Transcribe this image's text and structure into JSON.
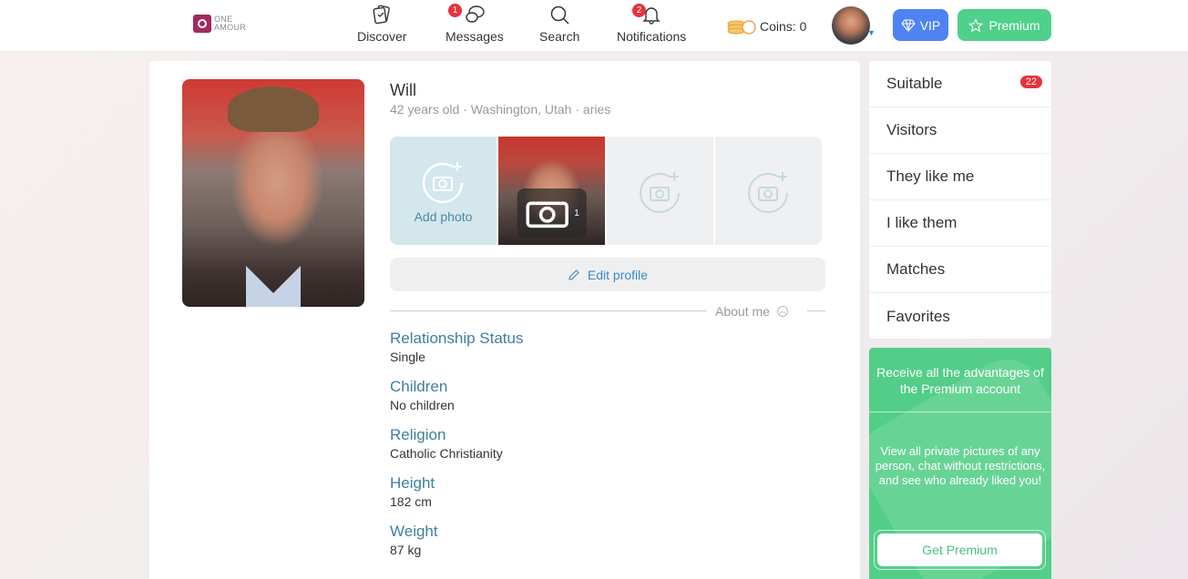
{
  "header": {
    "logo": {
      "line1": "ONE",
      "line2": "AMOUR"
    },
    "nav": [
      {
        "label": "Discover",
        "icon": "cards-icon",
        "badge": null
      },
      {
        "label": "Messages",
        "icon": "chat-bubbles-icon",
        "badge": "1"
      },
      {
        "label": "Search",
        "icon": "search-icon",
        "badge": null
      },
      {
        "label": "Notifications",
        "icon": "bell-icon",
        "badge": "2"
      }
    ],
    "coins_label": "Coins: 0",
    "vip_label": "VIP",
    "premium_label": "Premium",
    "colors": {
      "vip": "#4f83f3",
      "premium": "#4fd08b",
      "badge": "#e8323b"
    }
  },
  "profile": {
    "name": "Will",
    "subtitle": "42 years old · Washington, Utah · aries",
    "add_photo_label": "Add photo",
    "photo_count": "1",
    "edit_profile_label": "Edit profile",
    "about_label": "About me",
    "fields": [
      {
        "label": "Relationship Status",
        "value": "Single"
      },
      {
        "label": "Children",
        "value": "No children"
      },
      {
        "label": "Religion",
        "value": "Catholic Christianity"
      },
      {
        "label": "Height",
        "value": "182 cm"
      },
      {
        "label": "Weight",
        "value": "87 kg"
      }
    ]
  },
  "sidebar": {
    "items": [
      {
        "label": "Suitable",
        "badge": "22"
      },
      {
        "label": "Visitors",
        "badge": null
      },
      {
        "label": "They like me",
        "badge": null
      },
      {
        "label": "I like them",
        "badge": null
      },
      {
        "label": "Matches",
        "badge": null
      },
      {
        "label": "Favorites",
        "badge": null
      }
    ]
  },
  "promo": {
    "heading": "Receive all the advantages of the Premium account",
    "body": "View all private pictures of any person, chat without restrictions, and see who already liked you!",
    "button_label": "Get Premium",
    "color": "#52ce88"
  }
}
